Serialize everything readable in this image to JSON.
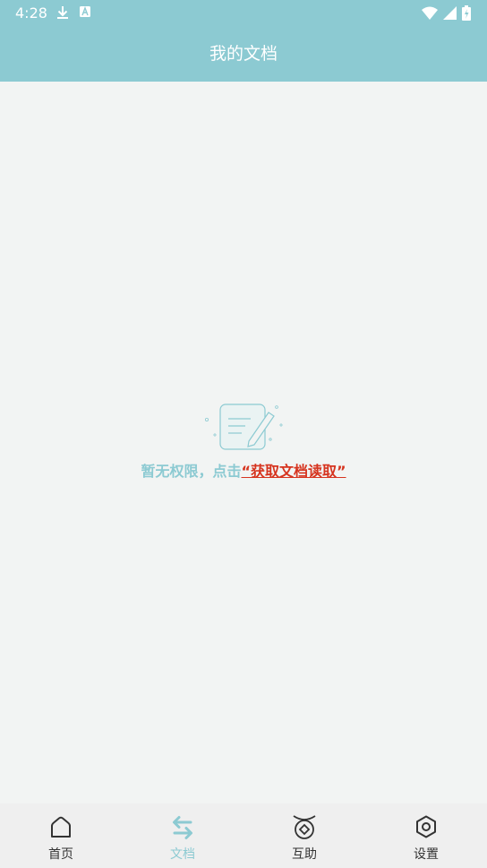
{
  "status_bar": {
    "time": "4:28"
  },
  "header": {
    "title": "我的文档"
  },
  "empty_state": {
    "message": "暂无权限，点击",
    "link": "“获取文档读取”"
  },
  "tabs": [
    {
      "label": "首页",
      "icon": "home-icon"
    },
    {
      "label": "文档",
      "icon": "swap-arrows-icon",
      "active": true
    },
    {
      "label": "互助",
      "icon": "mutual-help-icon"
    },
    {
      "label": "设置",
      "icon": "settings-hexagon-icon"
    }
  ],
  "colors": {
    "accent": "#8ccad2",
    "link": "#d6341f",
    "background": "#f2f4f3",
    "tabbar": "#efefef"
  }
}
